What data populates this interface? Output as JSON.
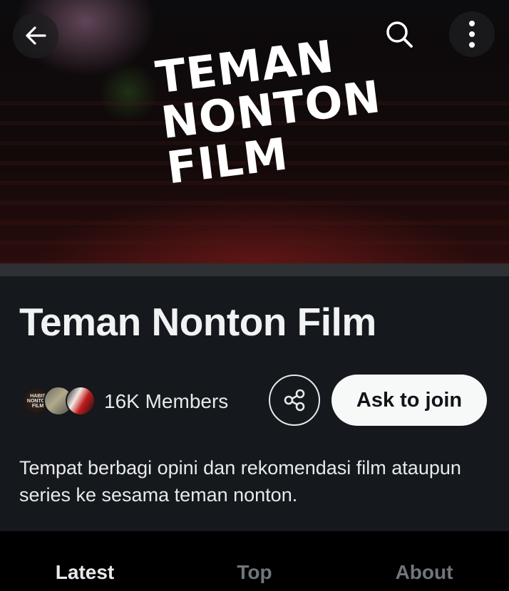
{
  "banner": {
    "logo_lines": [
      "TEMAN",
      "NONTON",
      "FILM"
    ]
  },
  "header": {
    "back_icon": "arrow-left-icon",
    "search_icon": "search-icon",
    "more_icon": "more-vertical-icon"
  },
  "community": {
    "name": "Teman Nonton Film",
    "members_label": "16K Members",
    "avatar_1_text": "HABIS NONTON FILM",
    "share_icon": "share-icon",
    "join_label": "Ask to join",
    "description": "Tempat berbagi opini dan rekomendasi film ataupun series ke sesama teman nonton."
  },
  "tabs": [
    {
      "label": "Latest",
      "active": true
    },
    {
      "label": "Top",
      "active": false
    },
    {
      "label": "About",
      "active": false
    }
  ],
  "colors": {
    "background": "#000000",
    "panel": "#15181c",
    "text_primary": "#e7e9ea",
    "text_muted": "#71767b",
    "join_button_bg": "#f7f9f9"
  }
}
